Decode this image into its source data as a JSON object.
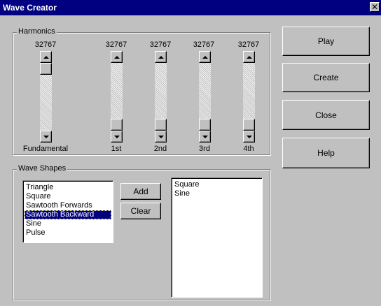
{
  "window": {
    "title": "Wave Creator",
    "close_glyph": "✕"
  },
  "harmonics": {
    "label": "Harmonics",
    "sliders": [
      {
        "value": "32767",
        "label": "Fundamental"
      },
      {
        "value": "32767",
        "label": "1st"
      },
      {
        "value": "32767",
        "label": "2nd"
      },
      {
        "value": "32767",
        "label": "3rd"
      },
      {
        "value": "32767",
        "label": "4th"
      }
    ]
  },
  "buttons": {
    "play": "Play",
    "create": "Create",
    "close": "Close",
    "help": "Help"
  },
  "wave_shapes": {
    "label": "Wave Shapes",
    "available": [
      "Triangle",
      "Square",
      "Sawtooth Forwards",
      "Sawtooth Backward",
      "Sine",
      "Pulse"
    ],
    "selected_index": 3,
    "add_label": "Add",
    "clear_label": "Clear",
    "chosen": [
      "Square",
      "Sine"
    ]
  },
  "colors": {
    "title_bar": "#000080",
    "face": "#c0c0c0",
    "selection": "#000080"
  }
}
